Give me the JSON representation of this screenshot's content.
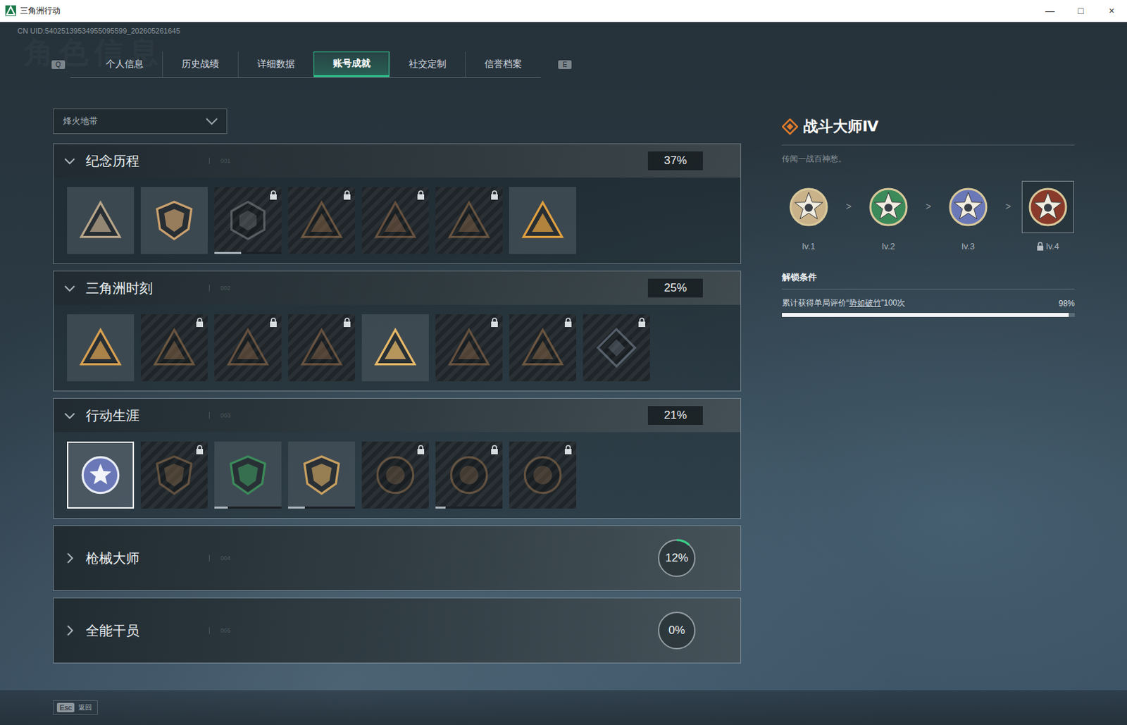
{
  "window": {
    "title": "三角洲行动",
    "controls": [
      "—",
      "□",
      "×"
    ]
  },
  "uid": "CN UID:54025139534955095599_202605261645",
  "watermark": "角色信息",
  "tabs": {
    "prev_key": "Q",
    "next_key": "E",
    "items": [
      {
        "label": "个人信息",
        "selected": false
      },
      {
        "label": "历史战绩",
        "selected": false
      },
      {
        "label": "详细数据",
        "selected": false
      },
      {
        "label": "账号成就",
        "selected": true
      },
      {
        "label": "社交定制",
        "selected": false
      },
      {
        "label": "信誉档案",
        "selected": false
      }
    ]
  },
  "mode_select": {
    "value": "烽火地带"
  },
  "sections": [
    {
      "title": "纪念历程",
      "number": "001",
      "percent": "37%",
      "expanded": true,
      "badges": [
        {
          "kind": "triangle",
          "color": "#b8a68a",
          "locked": false,
          "selected": false,
          "level": 0
        },
        {
          "kind": "shield",
          "color": "#c9a06e",
          "locked": false,
          "selected": false,
          "level": 0
        },
        {
          "kind": "hex",
          "color": "#8c8f94",
          "locked": true,
          "selected": false,
          "level": 0.4
        },
        {
          "kind": "triangle",
          "color": "#b08050",
          "locked": true,
          "selected": false,
          "level": 0
        },
        {
          "kind": "triangle",
          "color": "#a87650",
          "locked": true,
          "selected": false,
          "level": 0
        },
        {
          "kind": "triangle",
          "color": "#a87a50",
          "locked": true,
          "selected": false,
          "level": 0
        },
        {
          "kind": "triangle",
          "color": "#e0a040",
          "locked": false,
          "selected": false,
          "level": 0
        }
      ]
    },
    {
      "title": "三角洲时刻",
      "number": "002",
      "percent": "25%",
      "expanded": true,
      "badges": [
        {
          "kind": "triangle",
          "color": "#d8a050",
          "locked": false,
          "selected": false,
          "level": 0
        },
        {
          "kind": "triangle",
          "color": "#b08050",
          "locked": true,
          "selected": false,
          "level": 0
        },
        {
          "kind": "triangle",
          "color": "#a87850",
          "locked": true,
          "selected": false,
          "level": 0
        },
        {
          "kind": "triangle",
          "color": "#a87850",
          "locked": true,
          "selected": false,
          "level": 0
        },
        {
          "kind": "triangle",
          "color": "#e6b868",
          "locked": false,
          "selected": false,
          "level": 0
        },
        {
          "kind": "triangle",
          "color": "#a87850",
          "locked": true,
          "selected": false,
          "level": 0
        },
        {
          "kind": "triangle",
          "color": "#b08050",
          "locked": true,
          "selected": false,
          "level": 0
        },
        {
          "kind": "diamond",
          "color": "#8a98a8",
          "locked": true,
          "selected": false,
          "level": 0
        }
      ]
    },
    {
      "title": "行动生涯",
      "number": "003",
      "percent": "21%",
      "expanded": true,
      "badges": [
        {
          "kind": "star",
          "color": "#6a78b8",
          "locked": false,
          "selected": true,
          "level": 0
        },
        {
          "kind": "shield",
          "color": "#a07850",
          "locked": true,
          "selected": false,
          "level": 0
        },
        {
          "kind": "shield",
          "color": "#3c8a5a",
          "locked": false,
          "selected": false,
          "level": 0.2
        },
        {
          "kind": "shield",
          "color": "#c8a060",
          "locked": false,
          "selected": false,
          "level": 0.25
        },
        {
          "kind": "circle",
          "color": "#a07850",
          "locked": true,
          "selected": false,
          "level": 0
        },
        {
          "kind": "circle",
          "color": "#a07850",
          "locked": true,
          "selected": false,
          "level": 0.15
        },
        {
          "kind": "circle",
          "color": "#a07850",
          "locked": true,
          "selected": false,
          "level": 0
        }
      ]
    },
    {
      "title": "枪械大师",
      "number": "004",
      "percent": "12%",
      "expanded": false,
      "level": 0.12,
      "badges": []
    },
    {
      "title": "全能干员",
      "number": "005",
      "percent": "0%",
      "expanded": false,
      "level": 0,
      "badges": []
    }
  ],
  "detail": {
    "title": "战斗大师Ⅳ",
    "subtitle": "传闻一战百神愁。",
    "separator": ">",
    "levels": [
      {
        "label": "lv.1",
        "color": "#c9b28a",
        "locked": false,
        "selected": false
      },
      {
        "label": "lv.2",
        "color": "#3c8a5a",
        "locked": false,
        "selected": false
      },
      {
        "label": "lv.3",
        "color": "#6a78b8",
        "locked": false,
        "selected": false
      },
      {
        "label": "lv.4",
        "color": "#8a3a2a",
        "locked": true,
        "selected": true
      }
    ],
    "condition_title": "解锁条件",
    "condition": {
      "prefix": "累计获得单局评价“",
      "link": "势如破竹",
      "suffix": "”100次",
      "percent": "98%",
      "level": 0.98
    }
  },
  "footer": {
    "key": "Esc",
    "label": "返回"
  }
}
